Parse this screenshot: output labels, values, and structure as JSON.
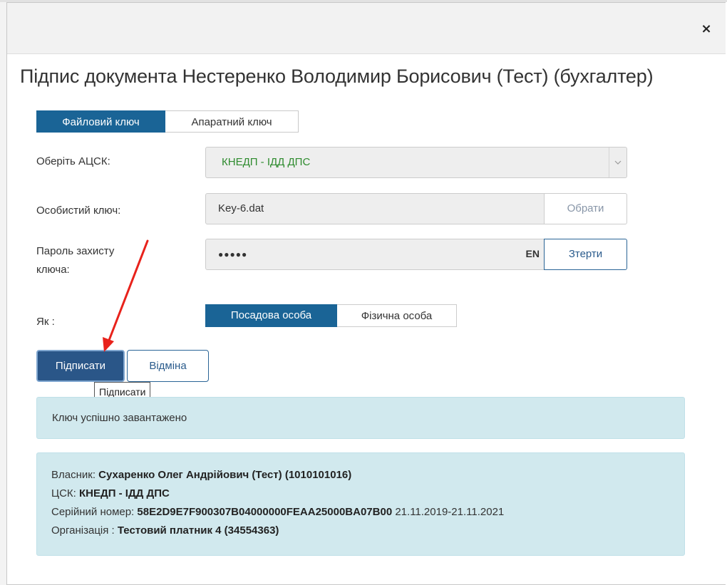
{
  "modal": {
    "close_glyph": "×",
    "title": "Підпис документа Нестеренко Володимир Борисович (Тест) (бухгалтер)"
  },
  "tabs": [
    {
      "label": "Файловий ключ",
      "active": true
    },
    {
      "label": "Апаратний ключ",
      "active": false
    }
  ],
  "form": {
    "acsk_label": "Оберіть АЦСК:",
    "acsk_value": "КНЕДП - ІДД ДПС",
    "key_label": "Особистий ключ:",
    "key_value": "Key-6.dat",
    "key_button": "Обрати",
    "password_label_line1": "Пароль захисту",
    "password_label_line2": "ключа:",
    "password_value": "●●●●●",
    "password_lang": "EN",
    "password_button": "Зтерти",
    "as_label": "Як :",
    "as_options": [
      {
        "label": "Посадова особа",
        "selected": true
      },
      {
        "label": "Фізична особа",
        "selected": false
      }
    ]
  },
  "actions": {
    "sign_label": "Підписати",
    "cancel_label": "Відміна",
    "tooltip": "Підписати"
  },
  "messages": {
    "success": "Ключ успішно завантажено"
  },
  "cert": {
    "owner_label": "Власник:",
    "owner_value": "Сухаренко Олег Андрійович (Тест) (1010101016)",
    "csk_label": "ЦСК:",
    "csk_value": "КНЕДП - ІДД ДПС",
    "serial_label": "Серійний номер:",
    "serial_value": "58E2D9E7F900307B04000000FEAA25000BA07B00",
    "validity": "21.11.2019-21.11.2021",
    "org_label": "Організація :",
    "org_value": "Тестовий платник 4 (34554363)"
  },
  "colors": {
    "primary": "#1a6496",
    "sign_button": "#2a5688",
    "alert_bg": "#d1e9ee",
    "acsk_text": "#2e8b2e",
    "annotation_arrow": "#e8221b"
  }
}
